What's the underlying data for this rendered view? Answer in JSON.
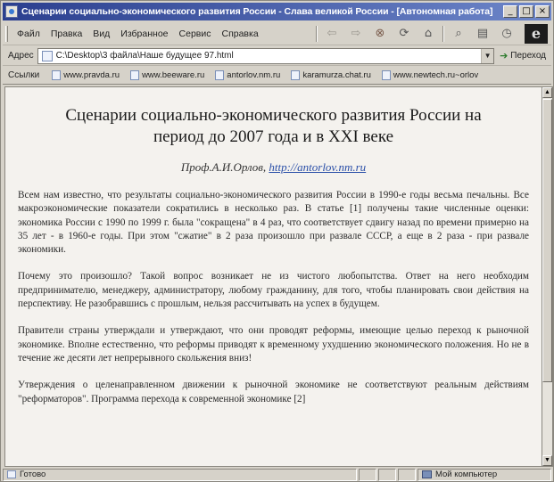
{
  "window": {
    "title": "Сценарии социально-экономического развития России - Слава великой России - [Автономная работа]"
  },
  "menu": {
    "items": [
      "Файл",
      "Правка",
      "Вид",
      "Избранное",
      "Сервис",
      "Справка"
    ]
  },
  "toolbar": {
    "icons": [
      "back-icon",
      "forward-icon",
      "stop-icon",
      "refresh-icon",
      "home-icon",
      "search-icon",
      "favorites-icon",
      "history-icon"
    ]
  },
  "address": {
    "label": "Адрес",
    "value": "C:\\Desktop\\3 файла\\Наше будущее 97.html",
    "go_label": "Переход"
  },
  "links": {
    "label": "Ссылки",
    "items": [
      "www.pravda.ru",
      "www.beeware.ru",
      "antorlov.nm.ru",
      "karamurza.chat.ru",
      "www.newtech.ru~orlov"
    ]
  },
  "document": {
    "title": "Сценарии социально-экономического развития России на период до 2007 года и в XXI веке",
    "author": "Проф.А.И.Орлов,",
    "author_link": "http://antorlov.nm.ru",
    "paragraphs": [
      "Всем нам известно, что результаты социально-экономического развития России в 1990-е годы весьма печальны. Все макроэкономические показатели сократились в несколько раз. В статье [1] получены такие численные оценки: экономика России с 1990 по 1999 г. была \"сокращена\" в 4 раз, что соответствует сдвигу назад по времени примерно на 35 лет - в 1960-е годы. При этом \"сжатие\" в 2 раза произошло при развале СССР, а еще в 2 раза - при развале экономики.",
      "Почему это произошло? Такой вопрос возникает не из чистого любопытства. Ответ на него необходим предпринимателю, менеджеру, администратору, любому гражданину, для того, чтобы планировать свои действия на перспективу. Не разобравшись с прошлым, нельзя рассчитывать на успех в будущем.",
      "Правители страны утверждали и утверждают, что они проводят реформы, имеющие целью переход к рыночной экономике. Вполне естественно, что реформы приводят к временному ухудшению экономического положения. Но не в течение же десяти лет непрерывного скольжения вниз!",
      "Утверждения о целенаправленном движении к рыночной экономике не соответствуют реальным действиям \"реформаторов\". Программа перехода к современной экономике [2]"
    ]
  },
  "status": {
    "left": "Готово",
    "right": "Мой компьютер"
  }
}
